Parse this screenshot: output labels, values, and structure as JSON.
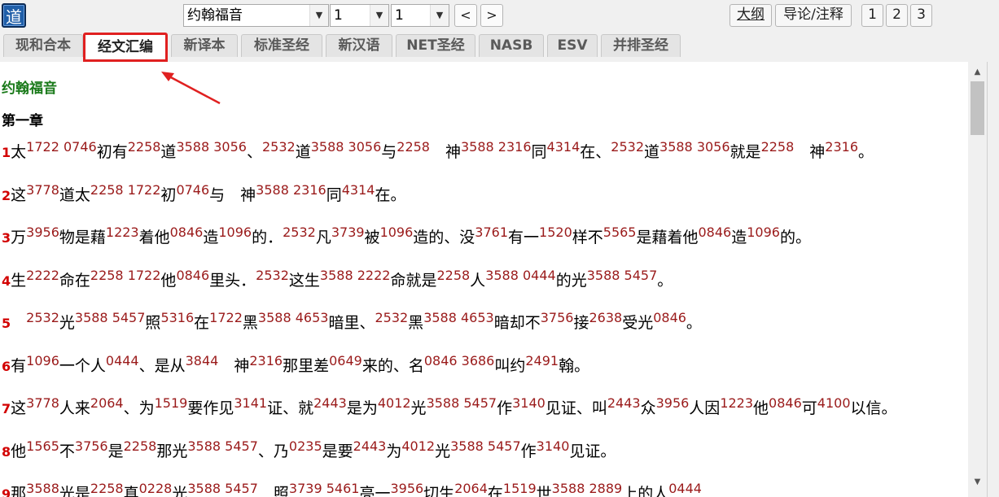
{
  "toolbar": {
    "logo_char": "道",
    "book_select": "约翰福音",
    "chapter_select": "1",
    "verse_select": "1",
    "prev_label": "<",
    "next_label": ">",
    "outline_label": "大纲",
    "intro_label": "导论/注释",
    "pages": [
      "1",
      "2",
      "3"
    ]
  },
  "tabs": [
    {
      "label": "现和合本"
    },
    {
      "label": "经文汇编"
    },
    {
      "label": "新译本"
    },
    {
      "label": "标准圣经"
    },
    {
      "label": "新汉语"
    },
    {
      "label": "NET圣经"
    },
    {
      "label": "NASB"
    },
    {
      "label": "ESV"
    },
    {
      "label": "并排圣经"
    }
  ],
  "active_tab": "经文汇编",
  "content": {
    "book_title": "约翰福音",
    "chapter_title": "第一章",
    "verses": [
      {
        "n": "1",
        "parts": [
          [
            "t",
            "太"
          ],
          [
            "s",
            "1722 0746"
          ],
          [
            "t",
            "初有"
          ],
          [
            "s",
            "2258"
          ],
          [
            "t",
            "道"
          ],
          [
            "s",
            "3588 3056"
          ],
          [
            "t",
            "、"
          ],
          [
            "s",
            "2532"
          ],
          [
            "t",
            "道"
          ],
          [
            "s",
            "3588 3056"
          ],
          [
            "t",
            "与"
          ],
          [
            "s",
            "2258"
          ],
          [
            "t",
            "　神"
          ],
          [
            "s",
            "3588 2316"
          ],
          [
            "t",
            "同"
          ],
          [
            "s",
            "4314"
          ],
          [
            "t",
            "在、"
          ],
          [
            "s",
            "2532"
          ],
          [
            "t",
            "道"
          ],
          [
            "s",
            "3588 3056"
          ],
          [
            "t",
            "就是"
          ],
          [
            "s",
            "2258"
          ],
          [
            "t",
            "　神"
          ],
          [
            "s",
            "2316"
          ],
          [
            "t",
            "。"
          ]
        ]
      },
      {
        "n": "2",
        "parts": [
          [
            "t",
            "这"
          ],
          [
            "s",
            "3778"
          ],
          [
            "t",
            "道太"
          ],
          [
            "s",
            "2258 1722"
          ],
          [
            "t",
            "初"
          ],
          [
            "s",
            "0746"
          ],
          [
            "t",
            "与　神"
          ],
          [
            "s",
            "3588 2316"
          ],
          [
            "t",
            "同"
          ],
          [
            "s",
            "4314"
          ],
          [
            "t",
            "在。"
          ]
        ]
      },
      {
        "n": "3",
        "parts": [
          [
            "t",
            "万"
          ],
          [
            "s",
            "3956"
          ],
          [
            "t",
            "物是藉"
          ],
          [
            "s",
            "1223"
          ],
          [
            "t",
            "着他"
          ],
          [
            "s",
            "0846"
          ],
          [
            "t",
            "造"
          ],
          [
            "s",
            "1096"
          ],
          [
            "t",
            "的．"
          ],
          [
            "s",
            "2532"
          ],
          [
            "t",
            "凡"
          ],
          [
            "s",
            "3739"
          ],
          [
            "t",
            "被"
          ],
          [
            "s",
            "1096"
          ],
          [
            "t",
            "造的、没"
          ],
          [
            "s",
            "3761"
          ],
          [
            "t",
            "有一"
          ],
          [
            "s",
            "1520"
          ],
          [
            "t",
            "样不"
          ],
          [
            "s",
            "5565"
          ],
          [
            "t",
            "是藉着他"
          ],
          [
            "s",
            "0846"
          ],
          [
            "t",
            "造"
          ],
          [
            "s",
            "1096"
          ],
          [
            "t",
            "的。"
          ]
        ]
      },
      {
        "n": "4",
        "parts": [
          [
            "t",
            "生"
          ],
          [
            "s",
            "2222"
          ],
          [
            "t",
            "命在"
          ],
          [
            "s",
            "2258 1722"
          ],
          [
            "t",
            "他"
          ],
          [
            "s",
            "0846"
          ],
          [
            "t",
            "里头．"
          ],
          [
            "s",
            "2532"
          ],
          [
            "t",
            "这生"
          ],
          [
            "s",
            "3588 2222"
          ],
          [
            "t",
            "命就是"
          ],
          [
            "s",
            "2258"
          ],
          [
            "t",
            "人"
          ],
          [
            "s",
            "3588 0444"
          ],
          [
            "t",
            "的光"
          ],
          [
            "s",
            "3588 5457"
          ],
          [
            "t",
            "。"
          ]
        ]
      },
      {
        "n": "5",
        "parts": [
          [
            "t",
            "　"
          ],
          [
            "s",
            "2532"
          ],
          [
            "t",
            "光"
          ],
          [
            "s",
            "3588 5457"
          ],
          [
            "t",
            "照"
          ],
          [
            "s",
            "5316"
          ],
          [
            "t",
            "在"
          ],
          [
            "s",
            "1722"
          ],
          [
            "t",
            "黑"
          ],
          [
            "s",
            "3588 4653"
          ],
          [
            "t",
            "暗里、"
          ],
          [
            "s",
            "2532"
          ],
          [
            "t",
            "黑"
          ],
          [
            "s",
            "3588 4653"
          ],
          [
            "t",
            "暗却不"
          ],
          [
            "s",
            "3756"
          ],
          [
            "t",
            "接"
          ],
          [
            "s",
            "2638"
          ],
          [
            "t",
            "受光"
          ],
          [
            "s",
            "0846"
          ],
          [
            "t",
            "。"
          ]
        ]
      },
      {
        "n": "6",
        "parts": [
          [
            "t",
            "有"
          ],
          [
            "s",
            "1096"
          ],
          [
            "t",
            "一个人"
          ],
          [
            "s",
            "0444"
          ],
          [
            "t",
            "、是从"
          ],
          [
            "s",
            "3844"
          ],
          [
            "t",
            "　神"
          ],
          [
            "s",
            "2316"
          ],
          [
            "t",
            "那里差"
          ],
          [
            "s",
            "0649"
          ],
          [
            "t",
            "来的、名"
          ],
          [
            "s",
            "0846 3686"
          ],
          [
            "t",
            "叫约"
          ],
          [
            "s",
            "2491"
          ],
          [
            "t",
            "翰。"
          ]
        ]
      },
      {
        "n": "7",
        "parts": [
          [
            "t",
            "这"
          ],
          [
            "s",
            "3778"
          ],
          [
            "t",
            "人来"
          ],
          [
            "s",
            "2064"
          ],
          [
            "t",
            "、为"
          ],
          [
            "s",
            "1519"
          ],
          [
            "t",
            "要作见"
          ],
          [
            "s",
            "3141"
          ],
          [
            "t",
            "证、就"
          ],
          [
            "s",
            "2443"
          ],
          [
            "t",
            "是为"
          ],
          [
            "s",
            "4012"
          ],
          [
            "t",
            "光"
          ],
          [
            "s",
            "3588 5457"
          ],
          [
            "t",
            "作"
          ],
          [
            "s",
            "3140"
          ],
          [
            "t",
            "见证、叫"
          ],
          [
            "s",
            "2443"
          ],
          [
            "t",
            "众"
          ],
          [
            "s",
            "3956"
          ],
          [
            "t",
            "人因"
          ],
          [
            "s",
            "1223"
          ],
          [
            "t",
            "他"
          ],
          [
            "s",
            "0846"
          ],
          [
            "t",
            "可"
          ],
          [
            "s",
            "4100"
          ],
          [
            "t",
            "以信。"
          ]
        ]
      },
      {
        "n": "8",
        "parts": [
          [
            "t",
            "他"
          ],
          [
            "s",
            "1565"
          ],
          [
            "t",
            "不"
          ],
          [
            "s",
            "3756"
          ],
          [
            "t",
            "是"
          ],
          [
            "s",
            "2258"
          ],
          [
            "t",
            "那光"
          ],
          [
            "s",
            "3588 5457"
          ],
          [
            "t",
            "、乃"
          ],
          [
            "s",
            "0235"
          ],
          [
            "t",
            "是要"
          ],
          [
            "s",
            "2443"
          ],
          [
            "t",
            "为"
          ],
          [
            "s",
            "4012"
          ],
          [
            "t",
            "光"
          ],
          [
            "s",
            "3588 5457"
          ],
          [
            "t",
            "作"
          ],
          [
            "s",
            "3140"
          ],
          [
            "t",
            "见证。"
          ]
        ]
      },
      {
        "n": "9",
        "parts": [
          [
            "t",
            "那"
          ],
          [
            "s",
            "3588"
          ],
          [
            "t",
            "光是"
          ],
          [
            "s",
            "2258"
          ],
          [
            "t",
            "真"
          ],
          [
            "s",
            "0228"
          ],
          [
            "t",
            "光"
          ],
          [
            "s",
            "3588 5457"
          ],
          [
            "t",
            "　照"
          ],
          [
            "s",
            "3739 5461"
          ],
          [
            "t",
            "亮一"
          ],
          [
            "s",
            "3956"
          ],
          [
            "t",
            "切生"
          ],
          [
            "s",
            "2064"
          ],
          [
            "t",
            "在"
          ],
          [
            "s",
            "1519"
          ],
          [
            "t",
            "世"
          ],
          [
            "s",
            "3588 2889"
          ],
          [
            "t",
            "上的人"
          ],
          [
            "s",
            "0444"
          ]
        ]
      }
    ]
  },
  "colors": {
    "verse_number": "#d20000",
    "strong_number": "#9a1a1a",
    "book_title": "#1a7a1a",
    "highlight_box": "#e02020",
    "logo_bg": "#1f5ea8"
  }
}
